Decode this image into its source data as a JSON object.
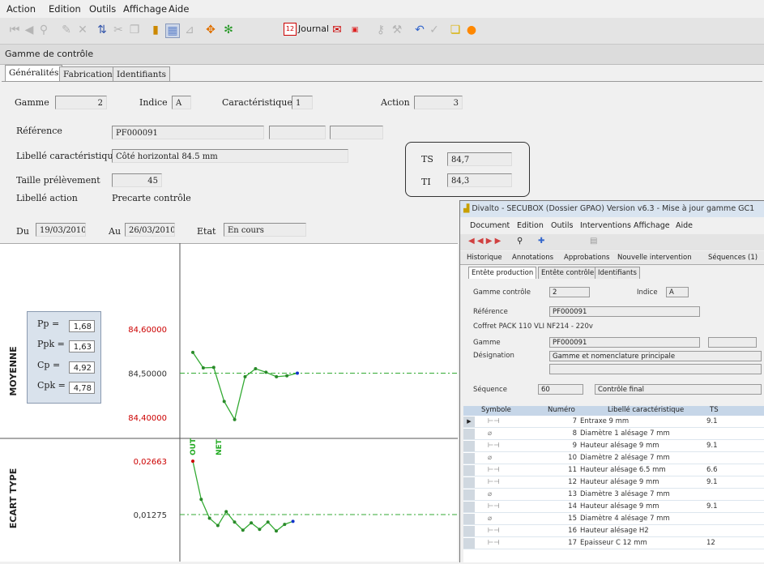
{
  "menu": [
    "Action",
    "Edition",
    "Outils",
    "Affichage",
    "Aide"
  ],
  "toolbar": {
    "journal_label": "Journal",
    "journal_day": "12"
  },
  "window_title": "Gamme de contrôle",
  "tabs": [
    "Généralités",
    "Fabrication",
    "Identifiants"
  ],
  "form": {
    "gamme_label": "Gamme",
    "gamme": "2",
    "indice_label": "Indice",
    "indice": "A",
    "caracteristique_label": "Caractéristique",
    "caracteristique": "1",
    "action_label": "Action",
    "action": "3",
    "reference_label": "Référence",
    "reference": "PF000091",
    "libelle_car_label": "Libellé caractéristique",
    "libelle_car": "Côté horizontal 84.5 mm",
    "taille_label": "Taille prélèvement",
    "taille": "45",
    "libelle_action_label": "Libellé action",
    "libelle_action": "Precarte contrôle",
    "ts_label": "TS",
    "ts": "84,7",
    "ti_label": "TI",
    "ti": "84,3",
    "du_label": "Du",
    "du": "19/03/2010",
    "au_label": "Au",
    "au": "26/03/2010",
    "etat_label": "Etat",
    "etat": "En cours"
  },
  "stats": {
    "pp_label": "Pp =",
    "pp": "1,68",
    "ppk_label": "Ppk =",
    "ppk": "1,63",
    "cp_label": "Cp =",
    "cp": "4,92",
    "cpk_label": "Cpk =",
    "cpk": "4,78"
  },
  "chart_data": [
    {
      "type": "line",
      "title": "MOYENNE",
      "y_ticks": [
        "84,60000",
        "84,50000",
        "84,40000"
      ],
      "y_values": [
        84.6,
        84.5,
        84.4
      ],
      "ylim": [
        84.6,
        84.4
      ],
      "series": [
        {
          "values": [
            84.547,
            84.512,
            84.513,
            84.436,
            84.395,
            84.492,
            84.51,
            84.502,
            84.492,
            84.494,
            84.5
          ]
        }
      ],
      "markers": [
        "OUT",
        "NET"
      ],
      "centerline": 84.5,
      "colors": {
        "line": "#33aa33",
        "tick_red": "#cc0000",
        "centerline": "#33aa33"
      }
    },
    {
      "type": "line",
      "title": "ECART TYPE",
      "y_ticks": [
        "0,02663",
        "0,01275"
      ],
      "y_values": [
        0.02663,
        0.01275
      ],
      "ylim": [
        0.02663,
        0.01275
      ],
      "series": [
        {
          "values": [
            0.0266,
            0.0167,
            0.0118,
            0.0099,
            0.0135,
            0.0108,
            0.0087,
            0.0106,
            0.0089,
            0.0108,
            0.0085,
            0.0102,
            0.011
          ]
        }
      ],
      "centerline": 0.01275
    }
  ],
  "secubox": {
    "title": "Divalto - SECUBOX (Dossier GPAO) Version v6.3 - Mise à jour gamme GC1",
    "menu": [
      "Document",
      "Edition",
      "Outils",
      "Interventions",
      "Affichage",
      "Aide"
    ],
    "tabs_top": [
      "Historique",
      "Annotations",
      "Approbations",
      "Nouvelle intervention",
      "Séquences (1)"
    ],
    "tabs": [
      "Entête production",
      "Entête contrôle",
      "Identifiants"
    ],
    "gamme_controle_label": "Gamme contrôle",
    "gamme_controle": "2",
    "indice_label": "Indice",
    "indice": "A",
    "reference_label": "Référence",
    "reference": "PF000091",
    "coffret": "Coffret PACK 110 VLI NF214 - 220v",
    "gamme_label": "Gamme",
    "gamme": "PF000091",
    "designation_label": "Désignation",
    "designation": "Gamme et nomenclature principale",
    "sequence_label": "Séquence",
    "sequence": "60",
    "sequence_lib": "Contrôle final",
    "grid_headers": [
      "Symbole",
      "Numéro",
      "Libellé caractéristique",
      "TS"
    ],
    "rows": [
      {
        "sym": "⊢⊣",
        "num": "7",
        "lib": "Entraxe 9 mm",
        "ts": "9.1"
      },
      {
        "sym": "⌀",
        "num": "8",
        "lib": "Diamètre 1 alésage 7 mm",
        "ts": ""
      },
      {
        "sym": "⊢⊣",
        "num": "9",
        "lib": "Hauteur alésage 9 mm",
        "ts": "9.1"
      },
      {
        "sym": "⌀",
        "num": "10",
        "lib": "Diamètre 2 alésage 7 mm",
        "ts": ""
      },
      {
        "sym": "⊢⊣",
        "num": "11",
        "lib": "Hauteur alésage 6.5 mm",
        "ts": "6.6"
      },
      {
        "sym": "⊢⊣",
        "num": "12",
        "lib": "Hauteur alésage 9 mm",
        "ts": "9.1"
      },
      {
        "sym": "⌀",
        "num": "13",
        "lib": "Diamètre 3 alésage 7 mm",
        "ts": ""
      },
      {
        "sym": "⊢⊣",
        "num": "14",
        "lib": "Hauteur alésage 9 mm",
        "ts": "9.1"
      },
      {
        "sym": "⌀",
        "num": "15",
        "lib": "Diamètre 4 alésage 7 mm",
        "ts": ""
      },
      {
        "sym": "⊢⊣",
        "num": "16",
        "lib": "Hauteur alésage H2",
        "ts": ""
      },
      {
        "sym": "⊢⊣",
        "num": "17",
        "lib": "Epaisseur C 12 mm",
        "ts": "12"
      }
    ]
  }
}
